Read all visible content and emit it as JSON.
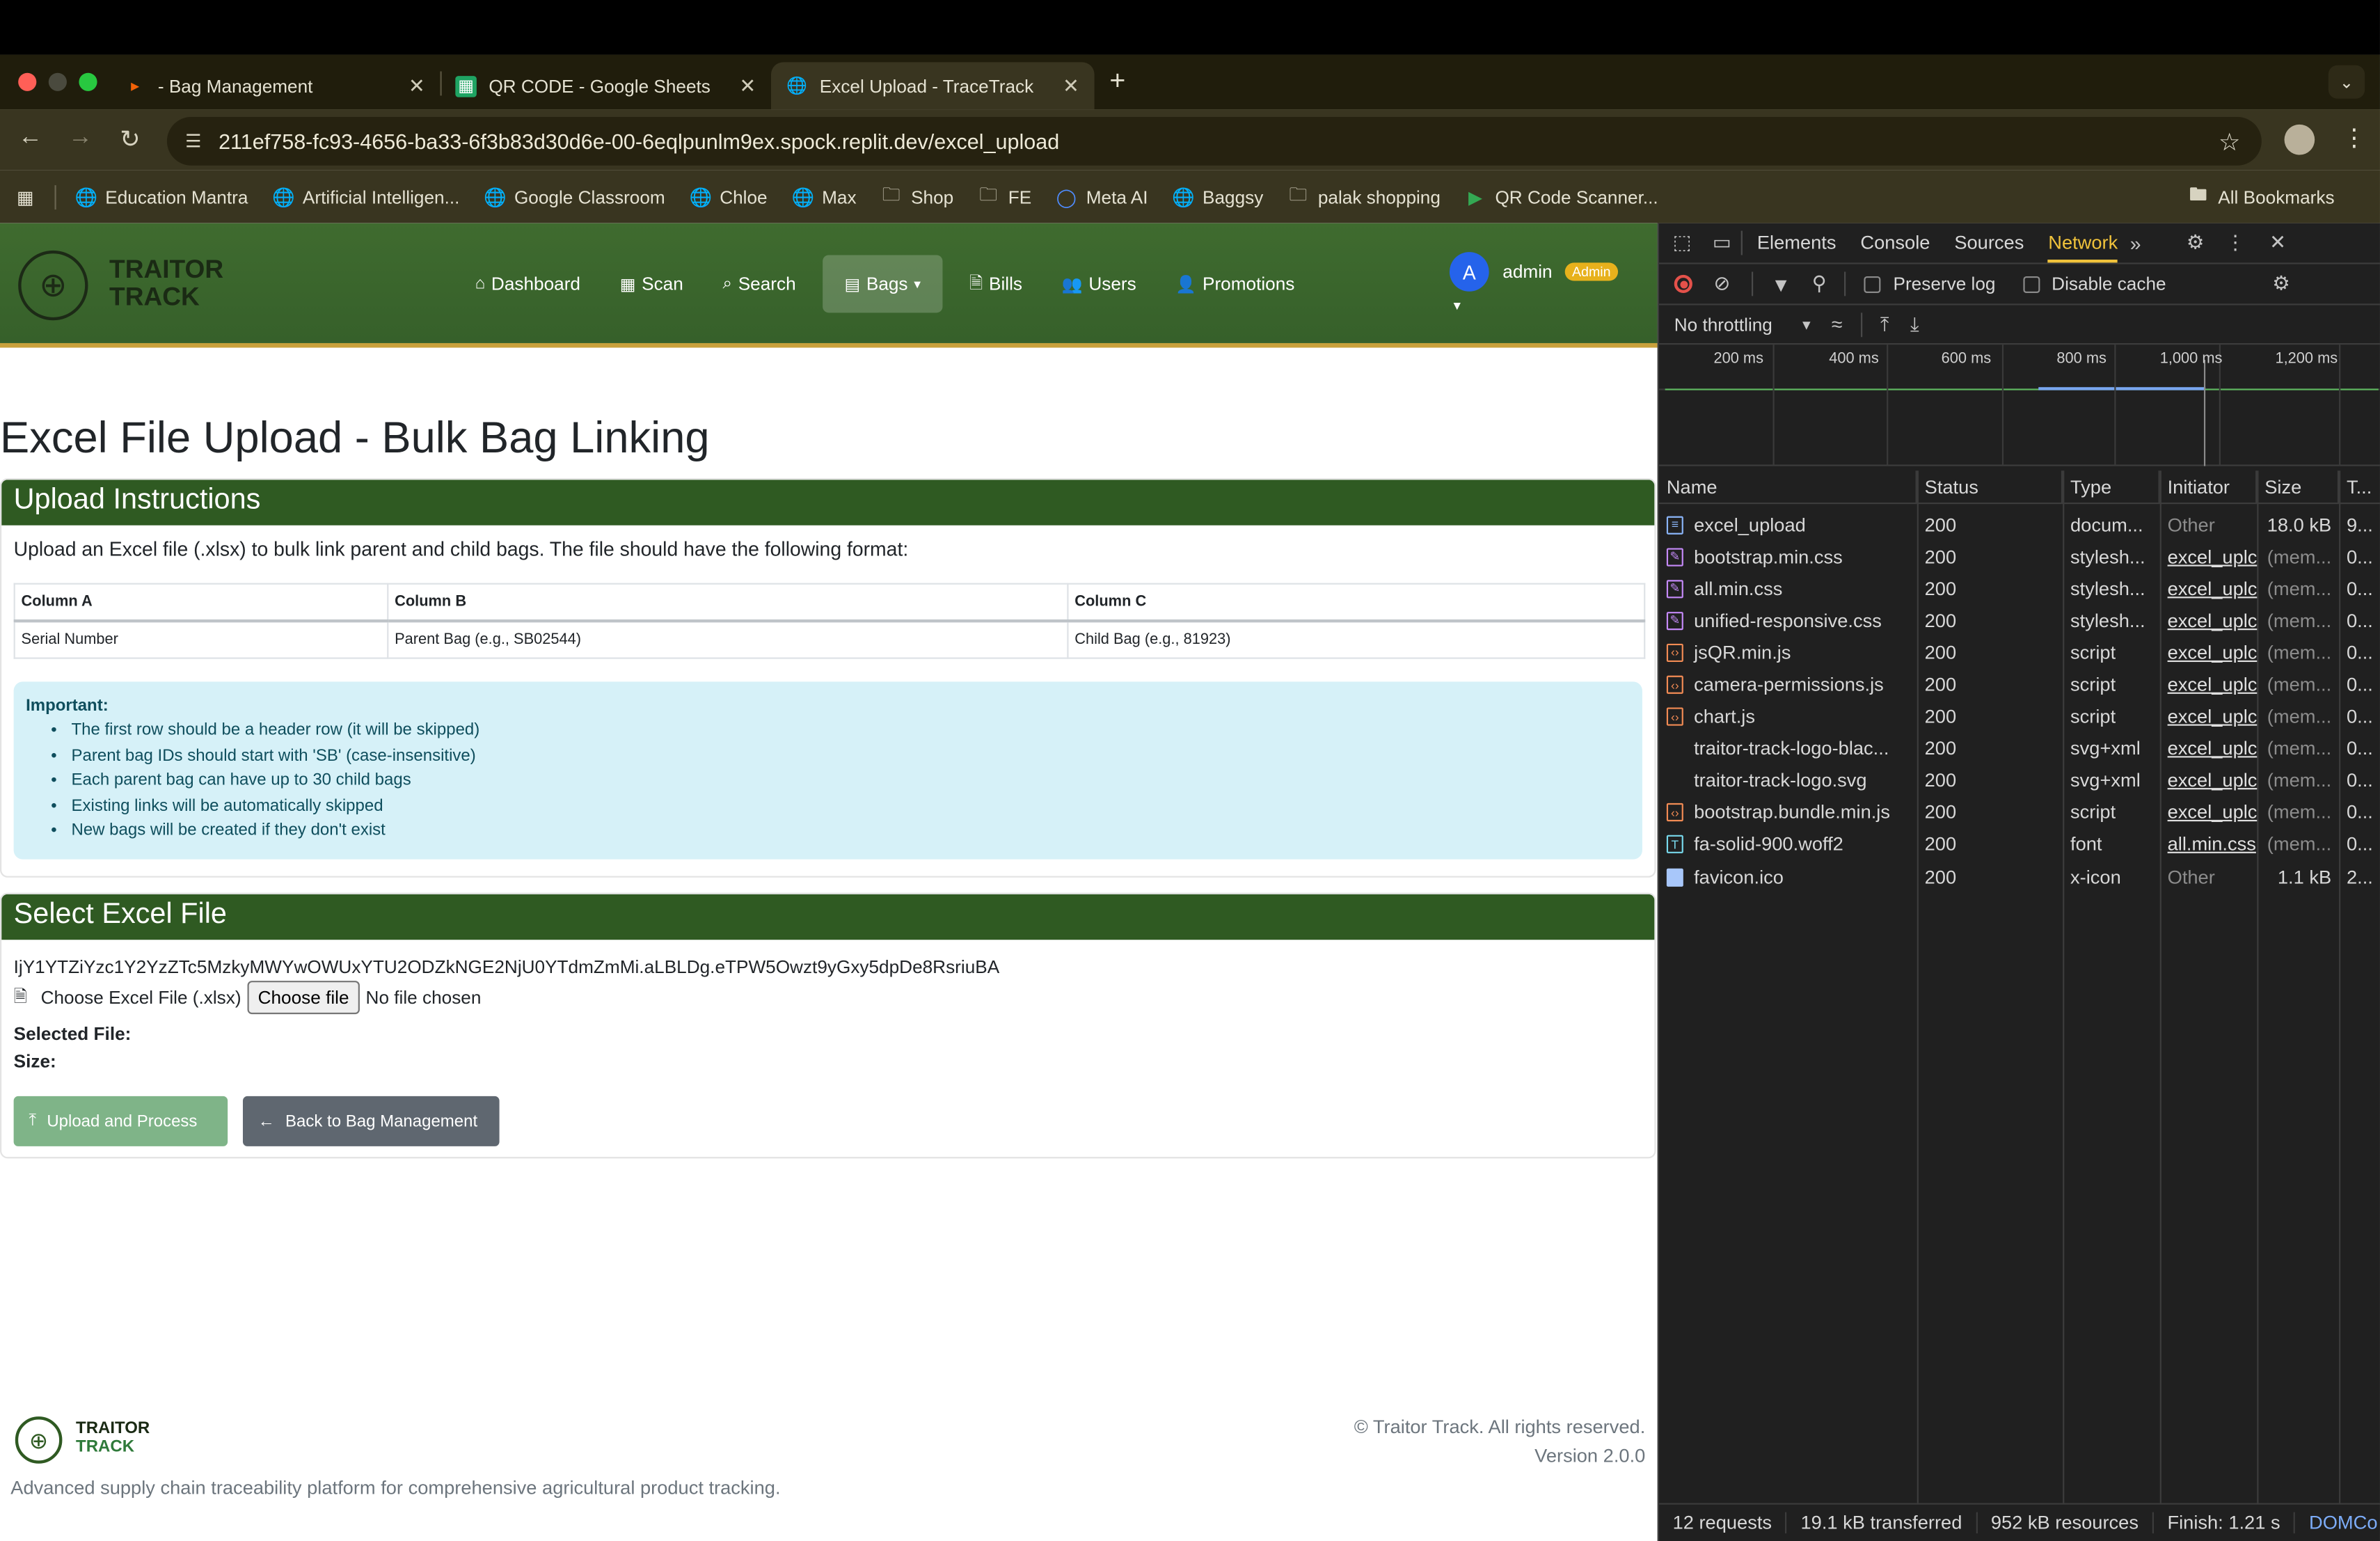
{
  "browser": {
    "tabs": [
      {
        "title": "- Bag Management",
        "icon": "replit-icon",
        "active": false
      },
      {
        "title": "QR CODE - Google Sheets",
        "icon": "sheets-icon",
        "active": false
      },
      {
        "title": "Excel Upload - TraceTrack",
        "icon": "globe-icon",
        "active": true
      }
    ],
    "url_host": "211ef758-fc93-4656-ba33-6f3b83d30d6e-00-6eqlpunlm9ex.spock.replit.dev",
    "url_path": "/excel_upload",
    "bookmarks": [
      {
        "label": "Education Mantra",
        "icon": "globe-icon"
      },
      {
        "label": "Artificial Intelligen...",
        "icon": "globe-icon"
      },
      {
        "label": "Google Classroom",
        "icon": "globe-icon"
      },
      {
        "label": "Chloe",
        "icon": "globe-icon"
      },
      {
        "label": "Max",
        "icon": "globe-icon"
      },
      {
        "label": "Shop",
        "icon": "folder-icon"
      },
      {
        "label": "FE",
        "icon": "folder-icon"
      },
      {
        "label": "Meta AI",
        "icon": "meta-icon"
      },
      {
        "label": "Baggsy",
        "icon": "globe-icon"
      },
      {
        "label": "palak shopping",
        "icon": "folder-icon"
      },
      {
        "label": "QR Code Scanner...",
        "icon": "play-icon"
      }
    ],
    "all_bookmarks": "All Bookmarks"
  },
  "app": {
    "brand_line1": "TRAITOR",
    "brand_line2": "TRACK",
    "nav": [
      {
        "label": "Dashboard",
        "icon": "home-icon"
      },
      {
        "label": "Scan",
        "icon": "qrcode-icon"
      },
      {
        "label": "Search",
        "icon": "search-icon"
      },
      {
        "label": "Bags",
        "icon": "boxes-icon",
        "active": true
      },
      {
        "label": "Bills",
        "icon": "file-icon"
      },
      {
        "label": "Users",
        "icon": "users-icon"
      },
      {
        "label": "Promotions",
        "icon": "user-tag-icon"
      }
    ],
    "user": {
      "initial": "A",
      "name": "admin",
      "role": "Admin"
    }
  },
  "main": {
    "title": "Excel File Upload - Bulk Bag Linking",
    "instructions": {
      "header": "Upload Instructions",
      "intro": "Upload an Excel file (.xlsx) to bulk link parent and child bags. The file should have the following format:",
      "columns": [
        "Column A",
        "Column B",
        "Column C"
      ],
      "row": [
        "Serial Number",
        "Parent Bag (e.g., SB02544)",
        "Child Bag (e.g., 81923)"
      ],
      "important_title": "Important:",
      "important_items": [
        "The first row should be a header row (it will be skipped)",
        "Parent bag IDs should start with 'SB' (case-insensitive)",
        "Each parent bag can have up to 30 child bags",
        "Existing links will be automatically skipped",
        "New bags will be created if they don't exist"
      ]
    },
    "select": {
      "header": "Select Excel File",
      "token": "IjY1YTZiYzc1Y2YzZTc5MzkyMWYwOWUxYTU2ODZkNGE2NjU0YTdmZmMi.aLBLDg.eTPW5Owzt9yGxy5dpDe8RsriuBA",
      "file_label": "Choose Excel File (.xlsx)",
      "choose_button": "Choose file",
      "no_file": "No file chosen",
      "selected_file_label": "Selected File:",
      "size_label": "Size:",
      "upload_button": "Upload and Process",
      "back_button": "Back to Bag Management"
    }
  },
  "footer": {
    "brand_line1": "TRAITOR",
    "brand_line2": "TRACK",
    "description": "Advanced supply chain traceability platform for comprehensive agricultural product tracking.",
    "copyright": "© Traitor Track. All rights reserved.",
    "version": "Version 2.0.0"
  },
  "devtools": {
    "tabs": [
      "Elements",
      "Console",
      "Sources",
      "Network"
    ],
    "active_tab": "Network",
    "preserve_log": "Preserve log",
    "disable_cache": "Disable cache",
    "throttling": "No throttling",
    "timeline_labels": [
      "200 ms",
      "400 ms",
      "600 ms",
      "800 ms",
      "1,000 ms",
      "1,200 ms"
    ],
    "columns": [
      "Name",
      "Status",
      "Type",
      "Initiator",
      "Size",
      "T..."
    ],
    "requests": [
      {
        "name": "excel_upload",
        "status": "200",
        "type": "docum...",
        "initiator": "Other",
        "size": "18.0 kB",
        "time": "9...",
        "icon": "document-icon",
        "color": "#8ab4f8"
      },
      {
        "name": "bootstrap.min.css",
        "status": "200",
        "type": "stylesh...",
        "initiator": "excel_uplc",
        "size": "(mem...",
        "time": "0...",
        "icon": "stylesheet-icon",
        "color": "#c58af9"
      },
      {
        "name": "all.min.css",
        "status": "200",
        "type": "stylesh...",
        "initiator": "excel_uplc",
        "size": "(mem...",
        "time": "0...",
        "icon": "stylesheet-icon",
        "color": "#c58af9"
      },
      {
        "name": "unified-responsive.css",
        "status": "200",
        "type": "stylesh...",
        "initiator": "excel_uplc",
        "size": "(mem...",
        "time": "0...",
        "icon": "stylesheet-icon",
        "color": "#c58af9"
      },
      {
        "name": "jsQR.min.js",
        "status": "200",
        "type": "script",
        "initiator": "excel_uplc",
        "size": "(mem...",
        "time": "0...",
        "icon": "script-icon",
        "color": "#f28b54"
      },
      {
        "name": "camera-permissions.js",
        "status": "200",
        "type": "script",
        "initiator": "excel_uplc",
        "size": "(mem...",
        "time": "0...",
        "icon": "script-icon",
        "color": "#f28b54"
      },
      {
        "name": "chart.js",
        "status": "200",
        "type": "script",
        "initiator": "excel_uplc",
        "size": "(mem...",
        "time": "0...",
        "icon": "script-icon",
        "color": "#f28b54"
      },
      {
        "name": "traitor-track-logo-blac...",
        "status": "200",
        "type": "svg+xml",
        "initiator": "excel_uplc",
        "size": "(mem...",
        "time": "0...",
        "icon": "image-icon",
        "color": "#202020"
      },
      {
        "name": "traitor-track-logo.svg",
        "status": "200",
        "type": "svg+xml",
        "initiator": "excel_uplc",
        "size": "(mem...",
        "time": "0...",
        "icon": "image-icon",
        "color": "#202020"
      },
      {
        "name": "bootstrap.bundle.min.js",
        "status": "200",
        "type": "script",
        "initiator": "excel_uplc",
        "size": "(mem...",
        "time": "0...",
        "icon": "script-icon",
        "color": "#f28b54"
      },
      {
        "name": "fa-solid-900.woff2",
        "status": "200",
        "type": "font",
        "initiator": "all.min.css",
        "size": "(mem...",
        "time": "0...",
        "icon": "font-icon",
        "color": "#78d9ec"
      },
      {
        "name": "favicon.ico",
        "status": "200",
        "type": "x-icon",
        "initiator": "Other",
        "size": "1.1 kB",
        "time": "2...",
        "icon": "file-icon",
        "color": "#a8c7fa"
      }
    ],
    "status_bar": [
      "12 requests",
      "19.1 kB transferred",
      "952 kB resources",
      "Finish: 1.21 s",
      "DOMCo"
    ]
  }
}
